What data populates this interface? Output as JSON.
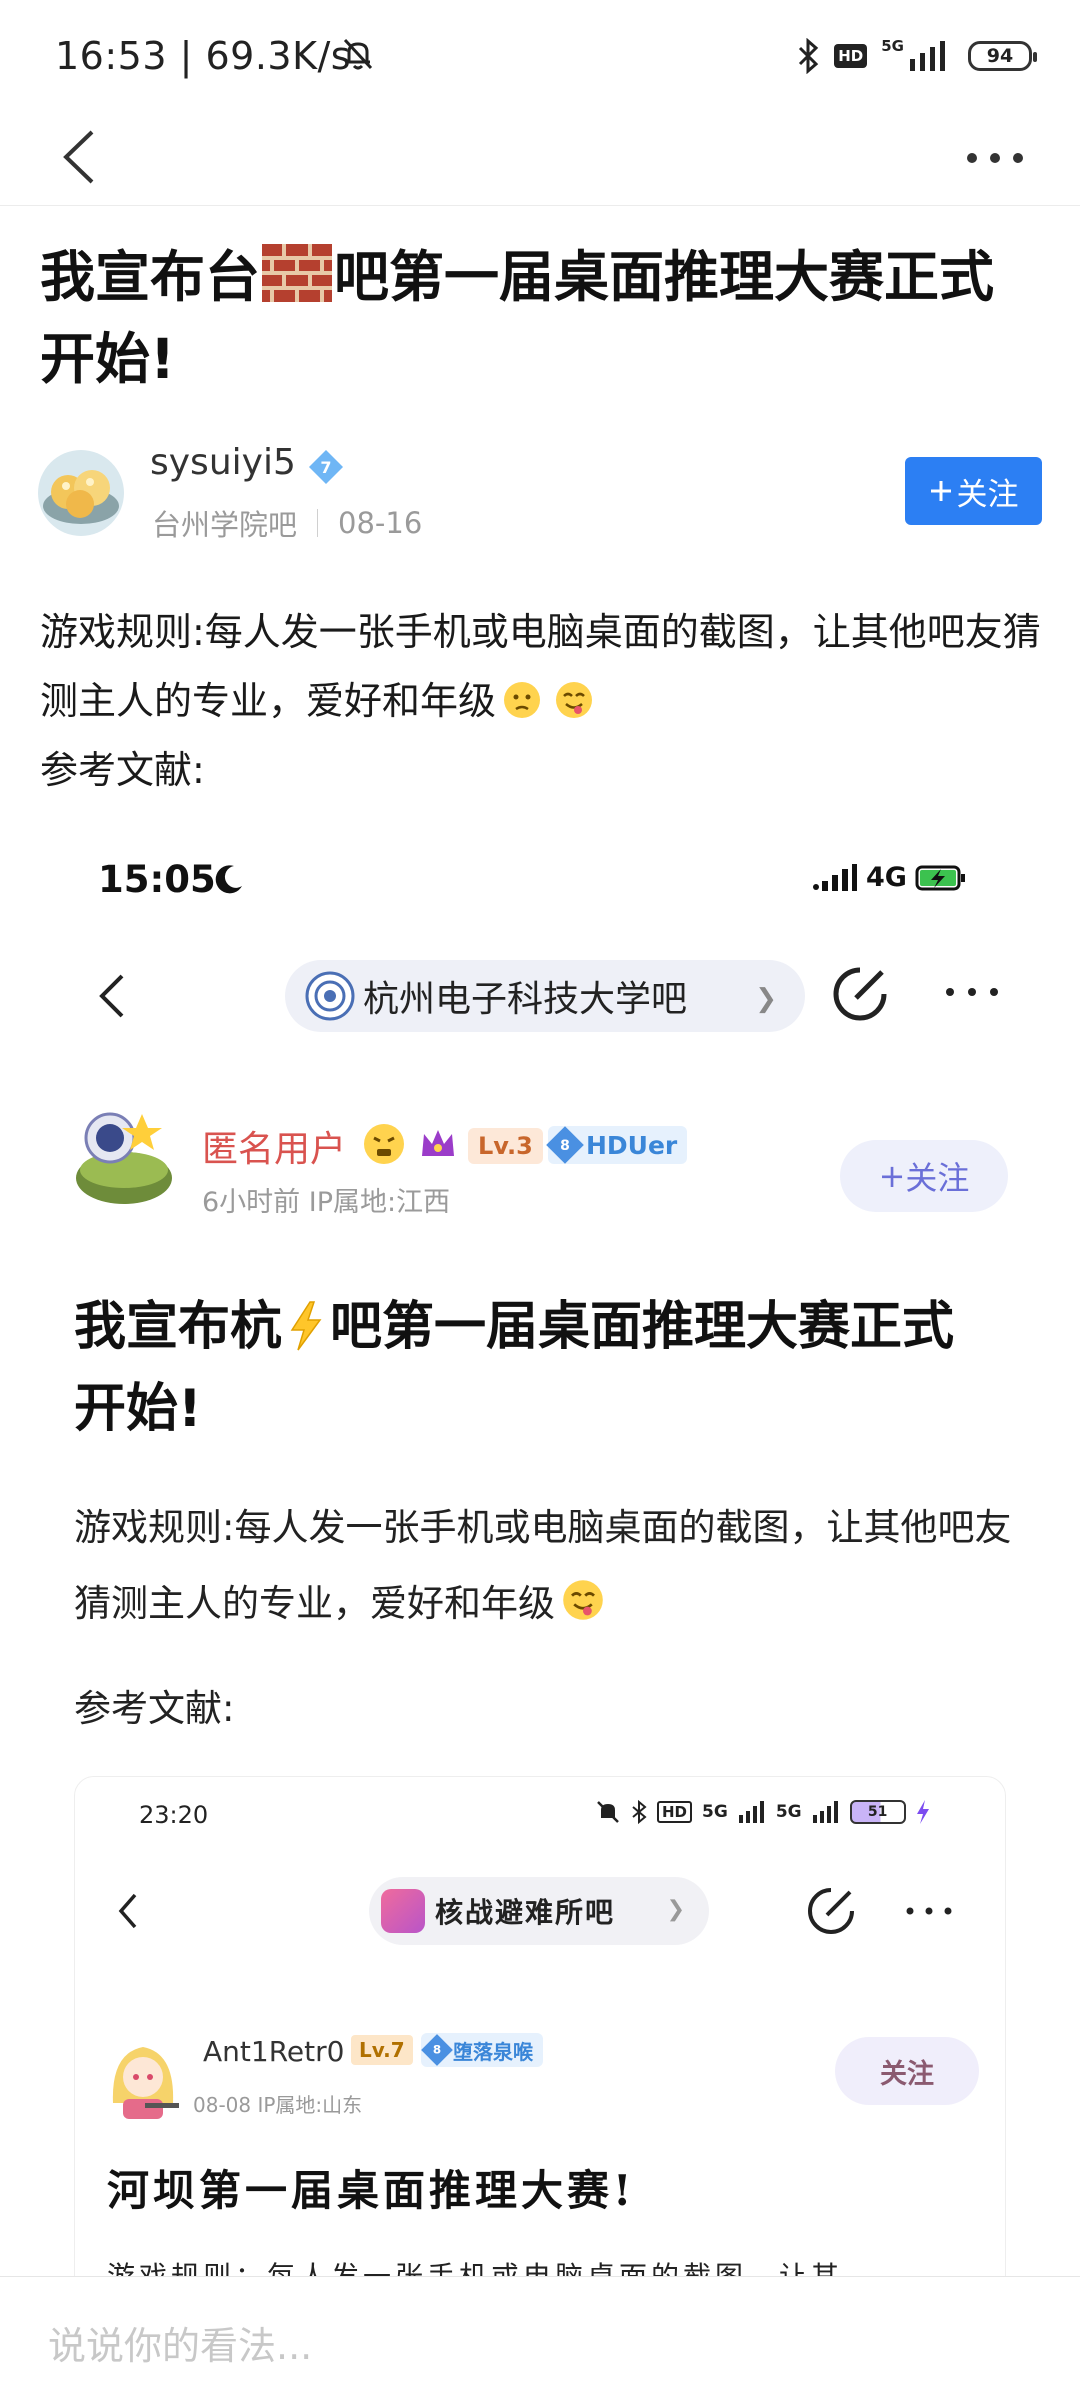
{
  "status_bar": {
    "time_speed": "16:53 | 69.3K/s",
    "network_type": "5G",
    "hd_label": "HD",
    "battery": "94"
  },
  "navbar": {
    "back_icon": "chevron-left-icon",
    "more_icon": "more-horizontal-icon"
  },
  "post": {
    "title_part1": "我宣布台",
    "title_part2": "吧第一届桌面推理大赛正式开始!",
    "author": "sysuiyi5",
    "author_level": "7",
    "forum": "台州学院吧",
    "date": "08-16",
    "follow_label": "关注",
    "body_line1": "游戏规则:每人发一张手机或电脑桌面的截图，让其他吧友猜测主人的专业，爱好和年级",
    "body_line2": "参考文献:"
  },
  "screenshot": {
    "time": "15:05",
    "network": "4G",
    "forum_name": "杭州电子科技大学吧",
    "user_name": "匿名用户",
    "level": "Lv.3",
    "badge_num": "8",
    "badge_text": "HDUer",
    "meta": "6小时前  IP属地:江西",
    "follow_label": "关注",
    "title_part1": "我宣布杭",
    "title_part2": "吧第一届桌面推理大赛正式开始!",
    "body": "游戏规则:每人发一张手机或电脑桌面的截图，让其他吧友猜测主人的专业，爱好和年级",
    "ref": "参考文献:"
  },
  "inner_screenshot": {
    "time": "23:20",
    "net1": "5G",
    "net2": "5G",
    "hd": "HD",
    "battery": "51",
    "forum_name": "核战避难所吧",
    "user_name": "Ant1Retr0",
    "level": "Lv.7",
    "badge_num": "8",
    "badge_text": "堕落泉喉",
    "meta": "08-08    IP属地:山东",
    "follow_label": "关注",
    "title": "河坝第一届桌面推理大赛!",
    "body_cut": "游戏规则：每人发一张手机或电脑桌面的截图，让其"
  },
  "comment": {
    "placeholder": "说说你的看法..."
  },
  "colors": {
    "accent": "#2c7ff3",
    "red_name": "#d9534f",
    "badge_blue": "#4a90e2"
  }
}
